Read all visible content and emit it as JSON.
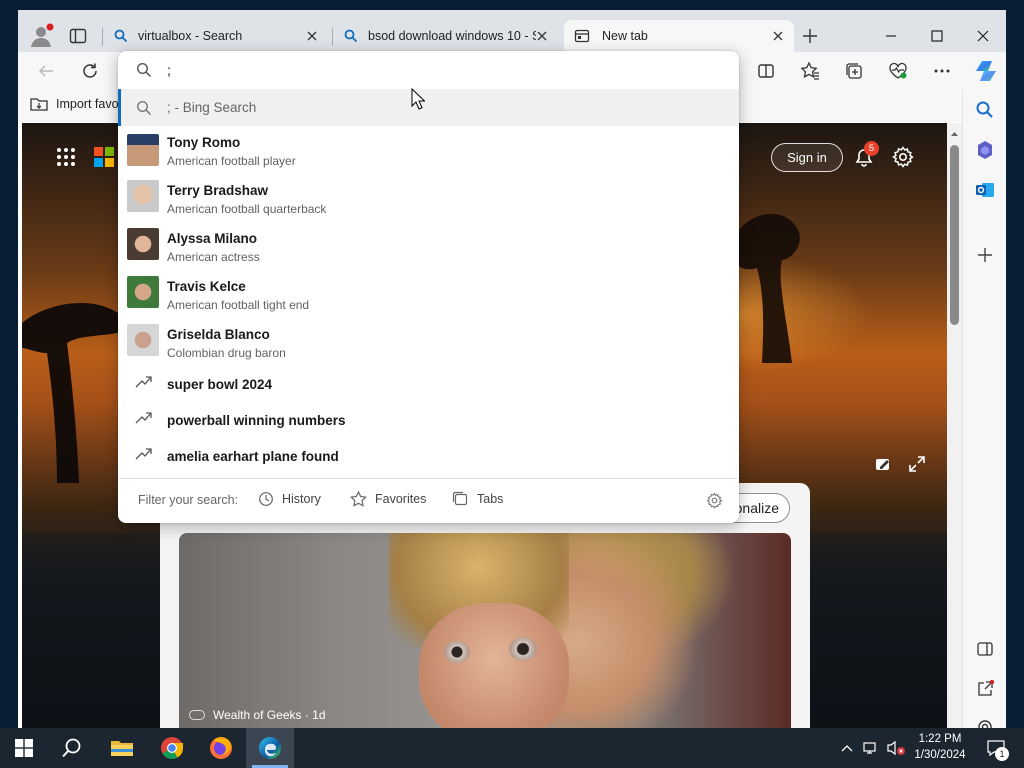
{
  "tabs": [
    {
      "label": "virtualbox - Search",
      "icon": "search-icon",
      "active": false
    },
    {
      "label": "bsod download windows 10 - S",
      "icon": "search-icon",
      "active": false
    },
    {
      "label": "New tab",
      "icon": "newtab-icon",
      "active": true
    }
  ],
  "address_bar": {
    "value": ";"
  },
  "favorites_bar": {
    "import_label": "Import favo"
  },
  "dropdown": {
    "bing_suggestion": "; - Bing Search",
    "entities": [
      {
        "name": "Tony Romo",
        "desc": "American football player"
      },
      {
        "name": "Terry Bradshaw",
        "desc": "American football quarterback"
      },
      {
        "name": "Alyssa Milano",
        "desc": "American actress"
      },
      {
        "name": "Travis Kelce",
        "desc": "American football tight end"
      },
      {
        "name": "Griselda Blanco",
        "desc": "Colombian drug baron"
      }
    ],
    "trending": [
      "super bowl 2024",
      "powerball winning numbers",
      "amelia earhart plane found"
    ],
    "filter": {
      "label": "Filter your search:",
      "history": "History",
      "favorites": "Favorites",
      "tabs": "Tabs"
    }
  },
  "ntp": {
    "sign_in": "Sign in",
    "notification_count": "5",
    "personalize_label": "onalize",
    "feed_source": "Wealth of Geeks · 1d"
  },
  "taskbar": {
    "time": "1:22 PM",
    "date": "1/30/2024",
    "notification_count": "1"
  },
  "colors": {
    "accent": "#0f6cbd",
    "badge": "#e8412a",
    "taskbar": "#1c2631"
  }
}
